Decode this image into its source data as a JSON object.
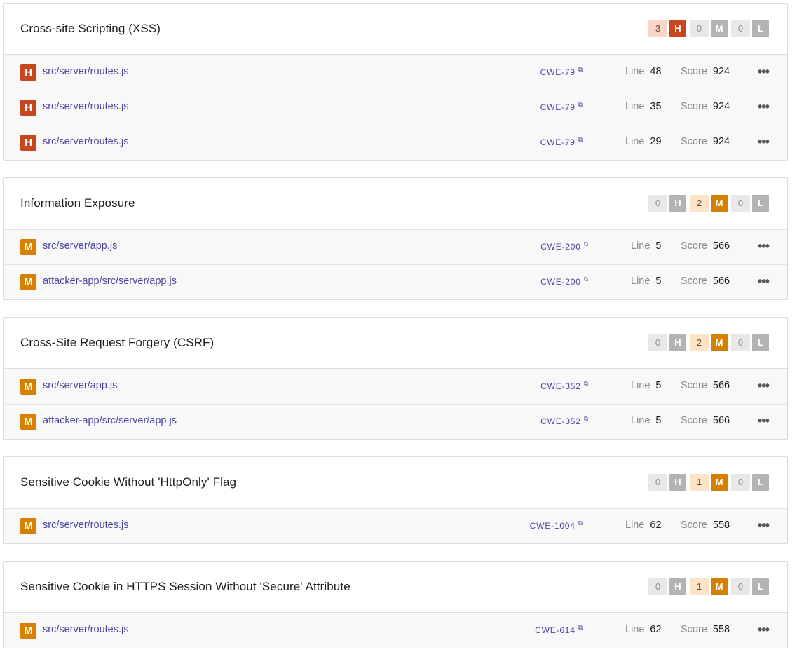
{
  "groups": [
    {
      "title": "Cross-site Scripting (XSS)",
      "counts": {
        "high": "3",
        "medium": "0",
        "low": "0"
      },
      "active": "high",
      "rows": [
        {
          "severity": "H",
          "path": "src/server/routes.js",
          "cwe": "CWE-79",
          "line": "48",
          "score": "924"
        },
        {
          "severity": "H",
          "path": "src/server/routes.js",
          "cwe": "CWE-79",
          "line": "35",
          "score": "924"
        },
        {
          "severity": "H",
          "path": "src/server/routes.js",
          "cwe": "CWE-79",
          "line": "29",
          "score": "924"
        }
      ]
    },
    {
      "title": "Information Exposure",
      "counts": {
        "high": "0",
        "medium": "2",
        "low": "0"
      },
      "active": "medium",
      "rows": [
        {
          "severity": "M",
          "path": "src/server/app.js",
          "cwe": "CWE-200",
          "line": "5",
          "score": "566"
        },
        {
          "severity": "M",
          "path": "attacker-app/src/server/app.js",
          "cwe": "CWE-200",
          "line": "5",
          "score": "566"
        }
      ]
    },
    {
      "title": "Cross-Site Request Forgery (CSRF)",
      "counts": {
        "high": "0",
        "medium": "2",
        "low": "0"
      },
      "active": "medium",
      "rows": [
        {
          "severity": "M",
          "path": "src/server/app.js",
          "cwe": "CWE-352",
          "line": "5",
          "score": "566"
        },
        {
          "severity": "M",
          "path": "attacker-app/src/server/app.js",
          "cwe": "CWE-352",
          "line": "5",
          "score": "566"
        }
      ]
    },
    {
      "title": "Sensitive Cookie Without 'HttpOnly' Flag",
      "counts": {
        "high": "0",
        "medium": "1",
        "low": "0"
      },
      "active": "medium",
      "rows": [
        {
          "severity": "M",
          "path": "src/server/routes.js",
          "cwe": "CWE-1004",
          "line": "62",
          "score": "558"
        }
      ]
    },
    {
      "title": "Sensitive Cookie in HTTPS Session Without 'Secure' Attribute",
      "counts": {
        "high": "0",
        "medium": "1",
        "low": "0"
      },
      "active": "medium",
      "rows": [
        {
          "severity": "M",
          "path": "src/server/routes.js",
          "cwe": "CWE-614",
          "line": "62",
          "score": "558"
        }
      ]
    }
  ],
  "labels": {
    "high_letter": "H",
    "medium_letter": "M",
    "low_letter": "L",
    "line": "Line",
    "score": "Score",
    "menu": "•••",
    "external_icon": "⧉"
  },
  "colors": {
    "high": "#c6461e",
    "medium": "#d68000",
    "high_count_bg": "#fbd5c8",
    "medium_count_bg": "#fde4c6",
    "inactive_count_bg": "#e8e8e8",
    "inactive_letter_bg": "#b3b3b3",
    "link": "#4b45a1"
  }
}
